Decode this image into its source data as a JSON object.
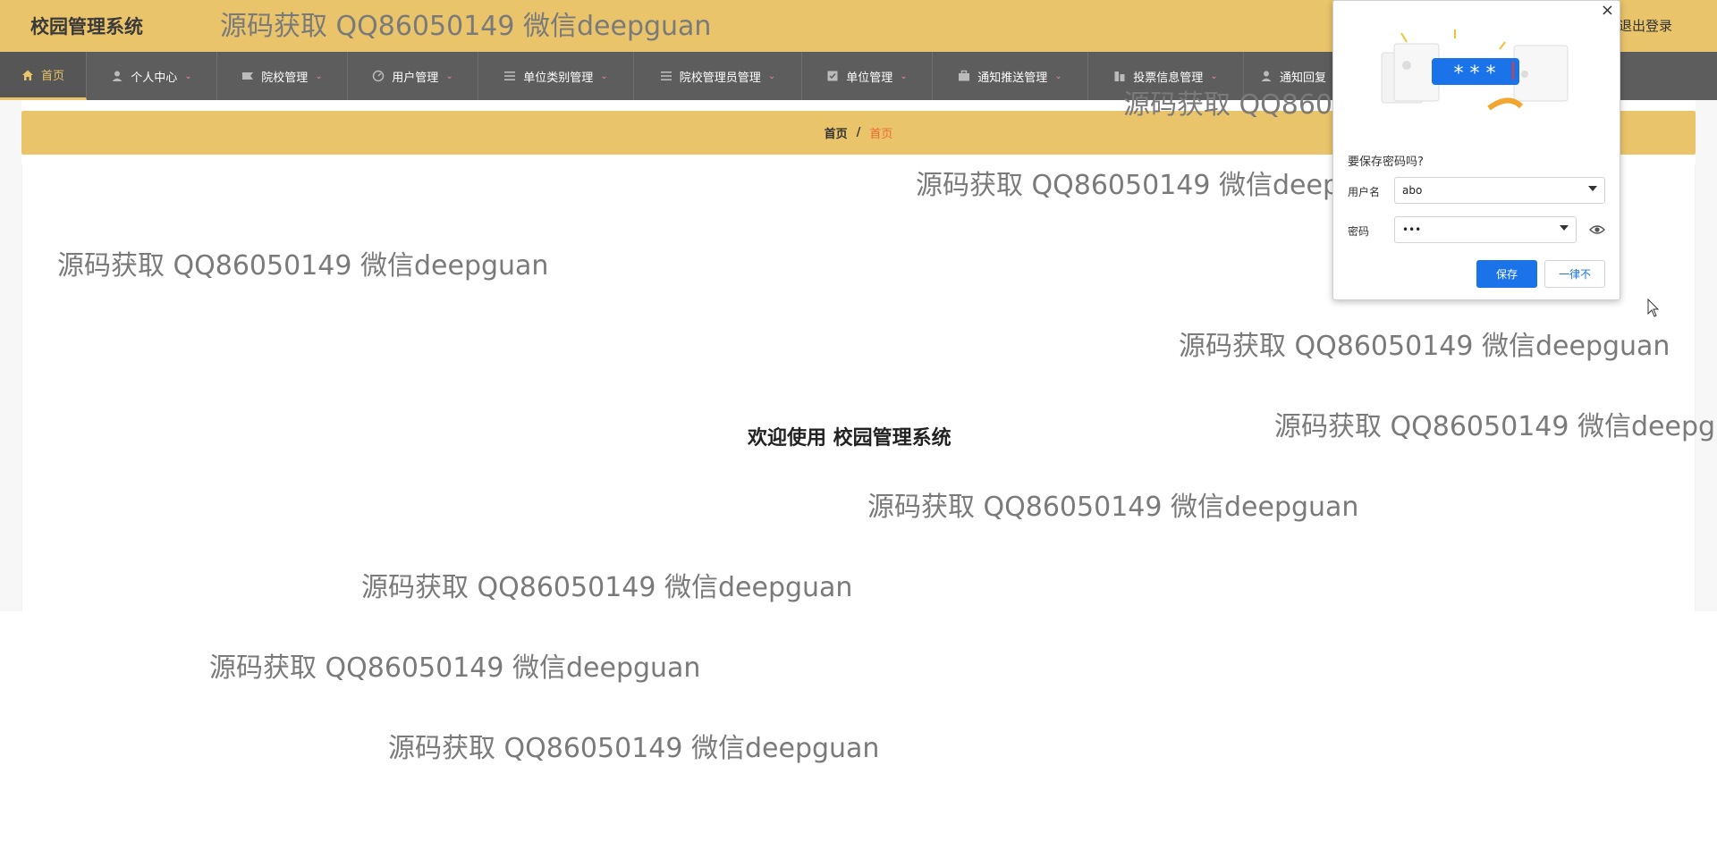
{
  "header": {
    "app_title": "校园管理系统",
    "logout_label": "退出登录"
  },
  "nav": {
    "items": [
      {
        "label": "首页",
        "icon": "home-icon",
        "active": true
      },
      {
        "label": "个人中心",
        "icon": "user-icon"
      },
      {
        "label": "院校管理",
        "icon": "flag-icon"
      },
      {
        "label": "用户管理",
        "icon": "dashboard-icon"
      },
      {
        "label": "单位类别管理",
        "icon": "list-icon"
      },
      {
        "label": "院校管理员管理",
        "icon": "list-icon"
      },
      {
        "label": "单位管理",
        "icon": "check-square-icon"
      },
      {
        "label": "通知推送管理",
        "icon": "briefcase-icon"
      },
      {
        "label": "投票信息管理",
        "icon": "building-icon"
      },
      {
        "label": "通知回复",
        "icon": "user-icon"
      }
    ]
  },
  "breadcrumb": {
    "home": "首页",
    "separator": "/",
    "current": "首页"
  },
  "main": {
    "welcome": "欢迎使用 校园管理系统"
  },
  "watermark": {
    "text": "源码获取 QQ86050149 微信deepguan"
  },
  "password_popup": {
    "title": "要保存密码吗?",
    "username_label": "用户名",
    "username_value": "abo",
    "password_label": "密码",
    "password_value": "•••",
    "illustration_text": "* * *",
    "save_label": "保存",
    "never_label": "一律不",
    "close_glyph": "×"
  },
  "colors": {
    "accent": "#e9c46a",
    "nav_bg": "#5d5d5d",
    "breadcrumb_current": "#f06a35",
    "primary_button": "#1a73e8"
  }
}
